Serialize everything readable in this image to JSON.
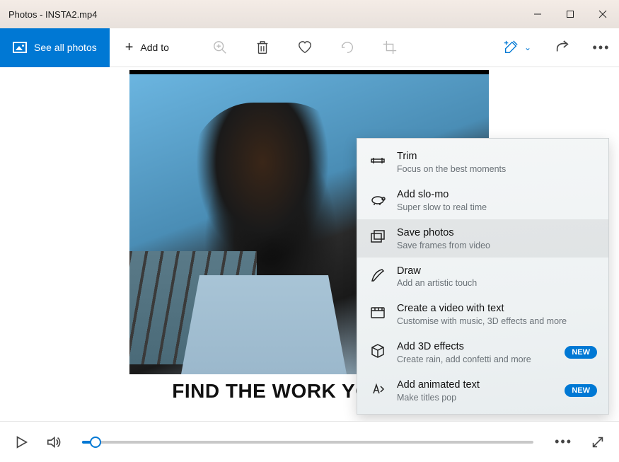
{
  "window": {
    "title": "Photos - INSTA2.mp4"
  },
  "toolbar": {
    "see_all": "See all photos",
    "add_to": "Add to"
  },
  "caption": "FIND THE WORK YOU LOVE",
  "menu": {
    "items": [
      {
        "title": "Trim",
        "sub": "Focus on the best moments",
        "badge": ""
      },
      {
        "title": "Add slo-mo",
        "sub": "Super slow to real time",
        "badge": ""
      },
      {
        "title": "Save photos",
        "sub": "Save frames from video",
        "badge": ""
      },
      {
        "title": "Draw",
        "sub": "Add an artistic touch",
        "badge": ""
      },
      {
        "title": "Create a video with text",
        "sub": "Customise with music, 3D effects and more",
        "badge": ""
      },
      {
        "title": "Add 3D effects",
        "sub": "Create rain, add confetti and more",
        "badge": "NEW"
      },
      {
        "title": "Add animated text",
        "sub": "Make titles pop",
        "badge": "NEW"
      }
    ]
  }
}
